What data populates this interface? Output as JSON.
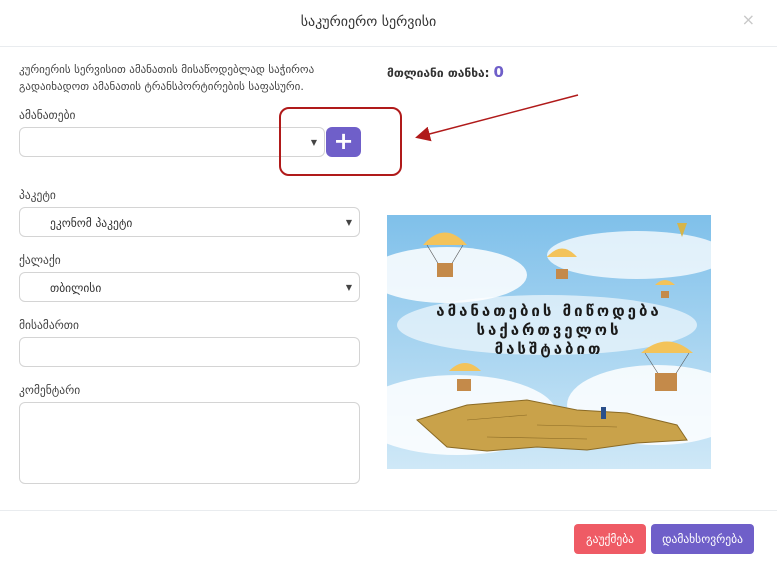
{
  "modal": {
    "title": "საკურიერო სერვისი",
    "close": "×",
    "note": "კურიერის სერვისით ამანათის მისაწოდებლად საჭიროა გადაიხადოთ ამანათის ტრანსპორტირების საფასური.",
    "total_label": "მთლიანი თანხა:",
    "total_value": "0"
  },
  "form": {
    "parcels_label": "ამანათები",
    "parcels_value": "",
    "add_symbol": "+",
    "package_label": "პაკეტი",
    "package_value": "ეკონომ პაკეტი",
    "city_label": "ქალაქი",
    "city_value": "თბილისი",
    "address_label": "მისამართი",
    "address_value": "",
    "comment_label": "კომენტარი",
    "comment_value": ""
  },
  "promo": {
    "line1": "ამანათების მიწოდება",
    "line2": "საქართველოს",
    "line3": "მასშტაბით"
  },
  "footer": {
    "cancel_label": "გაუქმება",
    "save_label": "დამახსოვრება"
  },
  "colors": {
    "accent": "#6f5fc9",
    "danger": "#ef5b65",
    "annotation": "#b01a1a",
    "sky": "#8ec8ec",
    "map": "#c9a24a"
  },
  "icons": [
    "close-icon",
    "plus-icon",
    "caret-down-icon",
    "annotation-arrow"
  ]
}
